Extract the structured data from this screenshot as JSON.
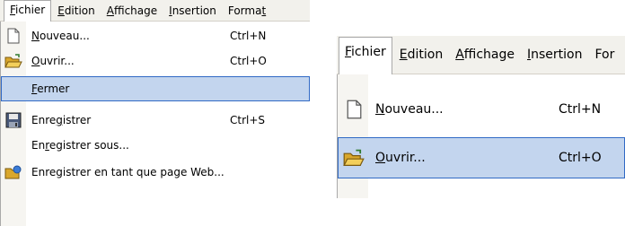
{
  "shot1": {
    "menubar": [
      {
        "pre": "",
        "key": "F",
        "post": "ichier"
      },
      {
        "pre": "",
        "key": "E",
        "post": "dition"
      },
      {
        "pre": "",
        "key": "A",
        "post": "ffichage"
      },
      {
        "pre": "",
        "key": "I",
        "post": "nsertion"
      },
      {
        "pre": "Forma",
        "key": "t",
        "post": ""
      }
    ],
    "items": [
      {
        "pre": "",
        "key": "N",
        "post": "ouveau...",
        "shortcut": "Ctrl+N",
        "icon": "new-document-icon"
      },
      {
        "pre": "",
        "key": "O",
        "post": "uvrir...",
        "shortcut": "Ctrl+O",
        "icon": "open-folder-icon"
      },
      {
        "pre": "",
        "key": "F",
        "post": "ermer",
        "shortcut": "",
        "icon": ""
      },
      {
        "pre": "Enre",
        "key": "g",
        "post": "istrer",
        "shortcut": "Ctrl+S",
        "icon": "floppy-disk-icon"
      },
      {
        "pre": "En",
        "key": "r",
        "post": "egistrer sous...",
        "shortcut": "",
        "icon": ""
      },
      {
        "pre": "Enregistrer en tant que page Web...",
        "key": "",
        "post": "",
        "shortcut": "",
        "icon": "web-page-icon"
      }
    ]
  },
  "shot2": {
    "menubar": [
      {
        "pre": "",
        "key": "F",
        "post": "ichier"
      },
      {
        "pre": "",
        "key": "E",
        "post": "dition"
      },
      {
        "pre": "",
        "key": "A",
        "post": "ffichage"
      },
      {
        "pre": "",
        "key": "I",
        "post": "nsertion"
      },
      {
        "pre": "For",
        "key": "",
        "post": ""
      }
    ],
    "items": [
      {
        "pre": "",
        "key": "N",
        "post": "ouveau...",
        "shortcut": "Ctrl+N",
        "icon": "new-document-icon"
      },
      {
        "pre": "",
        "key": "O",
        "post": "uvrir...",
        "shortcut": "Ctrl+O",
        "icon": "open-folder-icon"
      }
    ]
  },
  "colors": {
    "menubar_bg": "#f2f1ec",
    "gutter_bg": "#f6f5f1",
    "hover_bg": "#c3d5ee",
    "hover_border": "#316ac5"
  }
}
